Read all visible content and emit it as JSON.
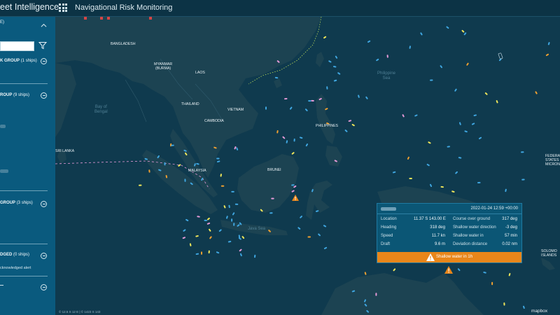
{
  "header": {
    "brand": "eet Intelligence",
    "title": "Navigational Risk Monitoring"
  },
  "sidebar": {
    "groups": [
      {
        "name": "K GROUP",
        "count": "(1 ships)"
      },
      {
        "name": "ROUP",
        "count": "(9 ships)"
      },
      {
        "name": "GROUP",
        "count": "(3 ships)"
      },
      {
        "name": "DGED",
        "count": "(0 ships)"
      }
    ],
    "top_label": "E)",
    "acknowledged_note": "cknowledged alert",
    "search": {
      "value": "",
      "placeholder": ""
    }
  },
  "map": {
    "labels": {
      "bangladesh": "BANGLADESH",
      "myanmar": "MYANMAR\n(BURMA)",
      "laos": "LAOS",
      "thailand": "THAILAND",
      "vietnam": "VIETNAM",
      "cambodia": "CAMBODIA",
      "philippines": "PHILIPPINES",
      "srilanka": "SRI LANKA",
      "malaysia": "MALAYSIA",
      "brunei": "BRUNEI",
      "us": "FEDERA\nSTATES\nMICRON",
      "solomon": "SOLOMO\nISLANDS"
    },
    "seas": {
      "bengal": "Bay of\nBengal",
      "philippine": "Philippine\nSea",
      "java": "Java Sea"
    },
    "attribution": "mapbox",
    "coord_readout": "© 12.5 S 12 E | © 1423 S 143"
  },
  "popup": {
    "timestamp": "2022-01-24 12:59 +00:00",
    "left": [
      {
        "label": "Location",
        "value": "11.37 S 143.00 E"
      },
      {
        "label": "Heading",
        "value": "318 deg"
      },
      {
        "label": "Speed",
        "value": "11.7 kn"
      },
      {
        "label": "Draft",
        "value": "9.6 m"
      }
    ],
    "right": [
      {
        "label": "Course over ground",
        "value": "317 deg"
      },
      {
        "label": "Shallow water direction",
        "value": "-3 deg"
      },
      {
        "label": "Shallow water in",
        "value": "57 min"
      },
      {
        "label": "Deviation distance",
        "value": "0.02 nm"
      }
    ],
    "alert": "Shallow water in 1h",
    "alert_color": "#e8861a"
  },
  "colors": {
    "ocean": "#0f3a4e",
    "land": "#1c4352",
    "sidebar": "#0a5a7e",
    "ship_blue": "#3fa6e0",
    "ship_yellow": "#f1e75a",
    "ship_pink": "#e69ad8",
    "ship_orange": "#f0a030"
  }
}
